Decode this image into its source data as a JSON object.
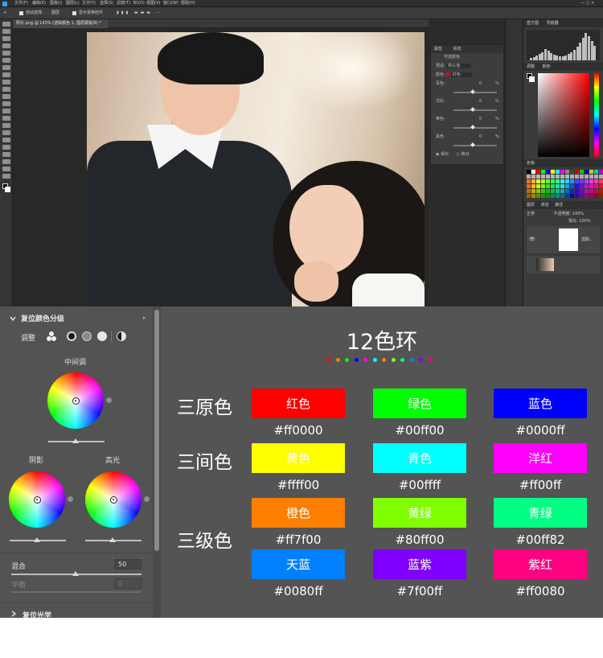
{
  "photoshop": {
    "menu": [
      "文件(F)",
      "编辑(E)",
      "图像(I)",
      "图层(L)",
      "文字(Y)",
      "选择(S)",
      "滤镜(T)",
      "3D(D)",
      "视图(V)",
      "窗口(W)",
      "帮助(H)"
    ],
    "options": {
      "auto_select": "自动选择:",
      "layer": "图层",
      "show_transform": "显示变换控件"
    },
    "doc_tab": "照片.png @ 143% (选取颜色 1, 图层蒙版/8) *",
    "properties": {
      "tabs": [
        "属性",
        "信息"
      ],
      "title": "可选颜色",
      "preset_label": "预设:",
      "preset_value": "默认值",
      "colors_label": "颜色:",
      "colors_value": "红色",
      "rows": [
        {
          "label": "青色:",
          "value": "0",
          "unit": "%"
        },
        {
          "label": "洋红:",
          "value": "0",
          "unit": "%"
        },
        {
          "label": "黄色:",
          "value": "0",
          "unit": "%"
        },
        {
          "label": "黑色:",
          "value": "0",
          "unit": "%"
        }
      ],
      "method_relative": "相对",
      "method_absolute": "绝对"
    },
    "dock": {
      "histogram_tabs": [
        "直方图",
        "导航器"
      ],
      "color_tabs": [
        "调整",
        "颜色"
      ],
      "swatches_tab": "色板",
      "layers_tabs": [
        "图层",
        "通道",
        "路径"
      ],
      "layer_mode": "正常",
      "opacity_label": "不透明度:",
      "opacity_value": "100%",
      "fill_label": "填充:",
      "fill_value": "100%",
      "layer_name": "选取..."
    }
  },
  "color_grading": {
    "title": "复位颜色分级",
    "adjust_label": "调整",
    "midtones_label": "中间调",
    "shadows_label": "阴影",
    "highlights_label": "高光",
    "blend_label": "混合",
    "blend_value": "50",
    "balance_label": "平衡",
    "balance_value": "0",
    "next_section": "复位光学"
  },
  "color_wheel": {
    "title": "12色环",
    "dot_colors": [
      "#ff0000",
      "#ff7f00",
      "#00ff00",
      "#0000ff",
      "#ff00ff",
      "#00ffff",
      "#ff7f00",
      "#80ff00",
      "#00ff82",
      "#0080ff",
      "#7f00ff",
      "#ff0080"
    ],
    "rows": [
      {
        "label": "三原色",
        "colors": [
          {
            "name": "红色",
            "hex": "#ff0000",
            "code": "#ff0000"
          },
          {
            "name": "绿色",
            "hex": "#00ff00",
            "code": "#00ff00"
          },
          {
            "name": "蓝色",
            "hex": "#0000ff",
            "code": "#0000ff"
          }
        ]
      },
      {
        "label": "三间色",
        "colors": [
          {
            "name": "黄色",
            "hex": "#ffff00",
            "code": "#ffff00"
          },
          {
            "name": "青色",
            "hex": "#00ffff",
            "code": "#00ffff"
          },
          {
            "name": "洋红",
            "hex": "#ff00ff",
            "code": "#ff00ff"
          }
        ]
      },
      {
        "label": "三级色",
        "colors": [
          {
            "name": "橙色",
            "hex": "#ff7f00",
            "code": "#ff7f00"
          },
          {
            "name": "黄绿",
            "hex": "#80ff00",
            "code": "#80ff00"
          },
          {
            "name": "青绿",
            "hex": "#00ff82",
            "code": "#00ff82"
          },
          {
            "name": "天蓝",
            "hex": "#0080ff",
            "code": "#0080ff"
          },
          {
            "name": "蓝紫",
            "hex": "#7f00ff",
            "code": "#7f00ff"
          },
          {
            "name": "紫红",
            "hex": "#ff0080",
            "code": "#ff0080"
          }
        ]
      }
    ]
  }
}
